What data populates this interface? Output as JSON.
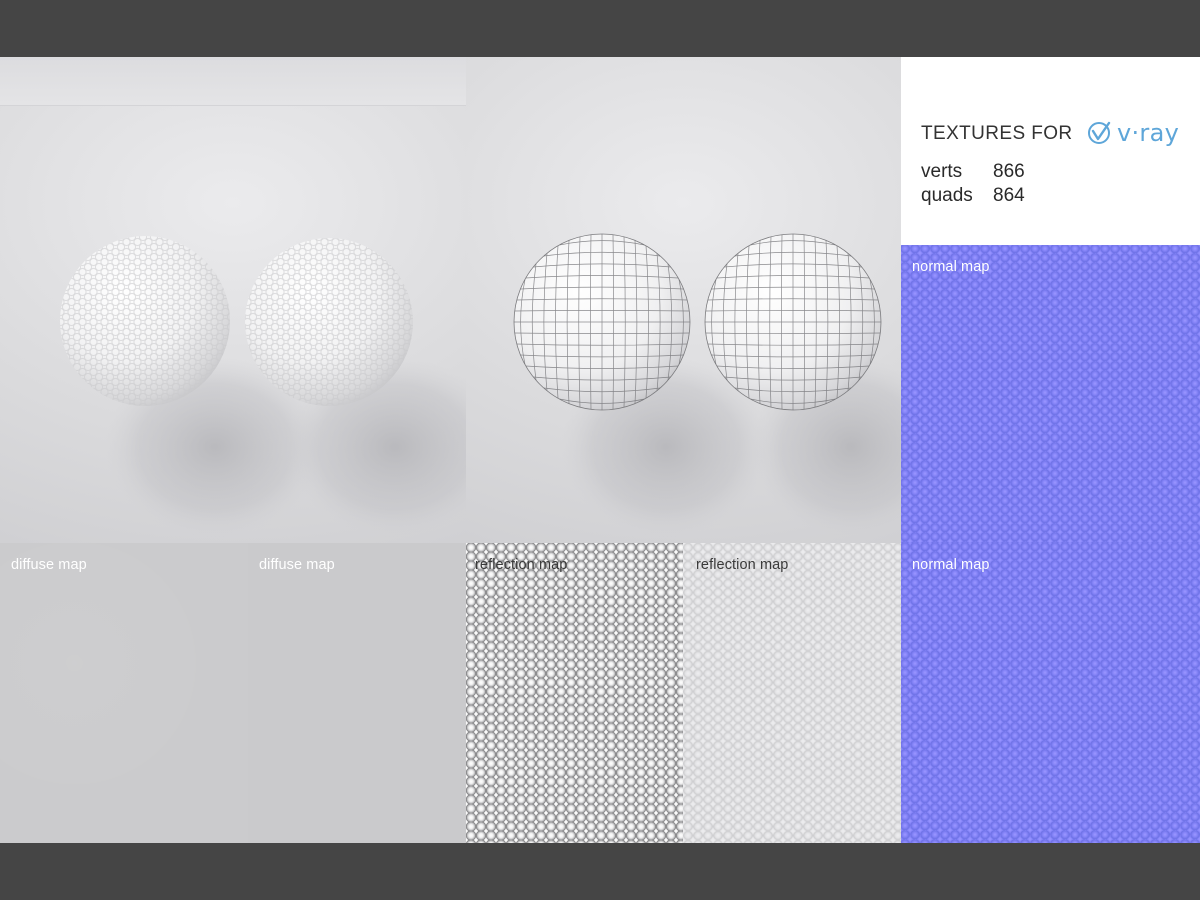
{
  "header": {
    "title": "TEXTURES FOR",
    "brand": "v·ray",
    "stats": [
      {
        "label": "verts",
        "value": "866"
      },
      {
        "label": "quads",
        "value": "864"
      }
    ]
  },
  "renders": [
    {
      "kind": "smooth"
    },
    {
      "kind": "wireframe"
    }
  ],
  "maps": [
    {
      "label": "normal map"
    },
    {
      "label": "diffuse map"
    },
    {
      "label": "diffuse map"
    },
    {
      "label": "reflection map"
    },
    {
      "label": "reflection map"
    },
    {
      "label": "normal map"
    }
  ],
  "colors": {
    "brand": "#5ea6d9",
    "normal_map": "#7f80f4",
    "frame": "#454545"
  }
}
